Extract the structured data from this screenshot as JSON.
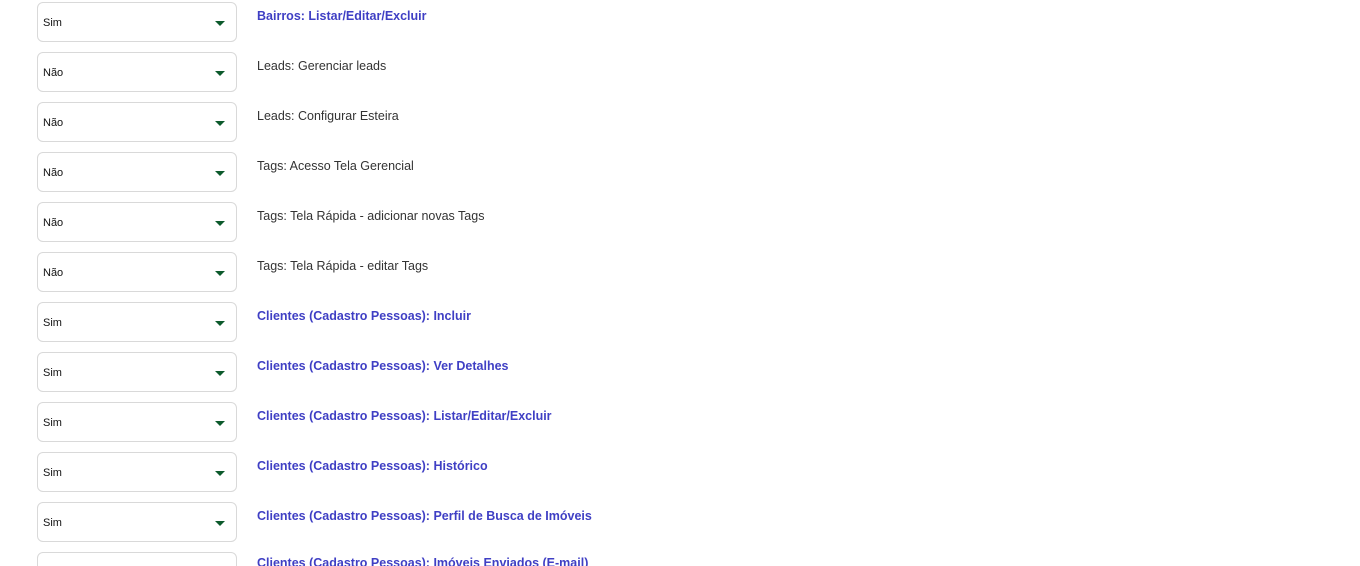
{
  "permissions": [
    {
      "value": "Sim",
      "label": "Bairros: Listar/Editar/Excluir",
      "enabled": true
    },
    {
      "value": "Não",
      "label": "Leads: Gerenciar leads",
      "enabled": false
    },
    {
      "value": "Não",
      "label": "Leads: Configurar Esteira",
      "enabled": false
    },
    {
      "value": "Não",
      "label": "Tags: Acesso Tela Gerencial",
      "enabled": false
    },
    {
      "value": "Não",
      "label": "Tags: Tela Rápida - adicionar novas Tags",
      "enabled": false
    },
    {
      "value": "Não",
      "label": "Tags: Tela Rápida - editar Tags",
      "enabled": false
    },
    {
      "value": "Sim",
      "label": "Clientes (Cadastro Pessoas): Incluir",
      "enabled": true
    },
    {
      "value": "Sim",
      "label": "Clientes (Cadastro Pessoas): Ver Detalhes",
      "enabled": true
    },
    {
      "value": "Sim",
      "label": "Clientes (Cadastro Pessoas): Listar/Editar/Excluir",
      "enabled": true
    },
    {
      "value": "Sim",
      "label": "Clientes (Cadastro Pessoas): Histórico",
      "enabled": true
    },
    {
      "value": "Sim",
      "label": "Clientes (Cadastro Pessoas): Perfil de Busca de Imóveis",
      "enabled": true
    },
    {
      "value": "",
      "label": "Clientes (Cadastro Pessoas): Imóveis Enviados (E-mail)",
      "enabled": true
    }
  ],
  "icons": {
    "dropdown": "chevron-down-icon"
  },
  "colors": {
    "enabled_label": "#3f3fc4",
    "disabled_label": "#333333",
    "arrow": "#0c5a2c",
    "border": "#d9d9d9"
  }
}
